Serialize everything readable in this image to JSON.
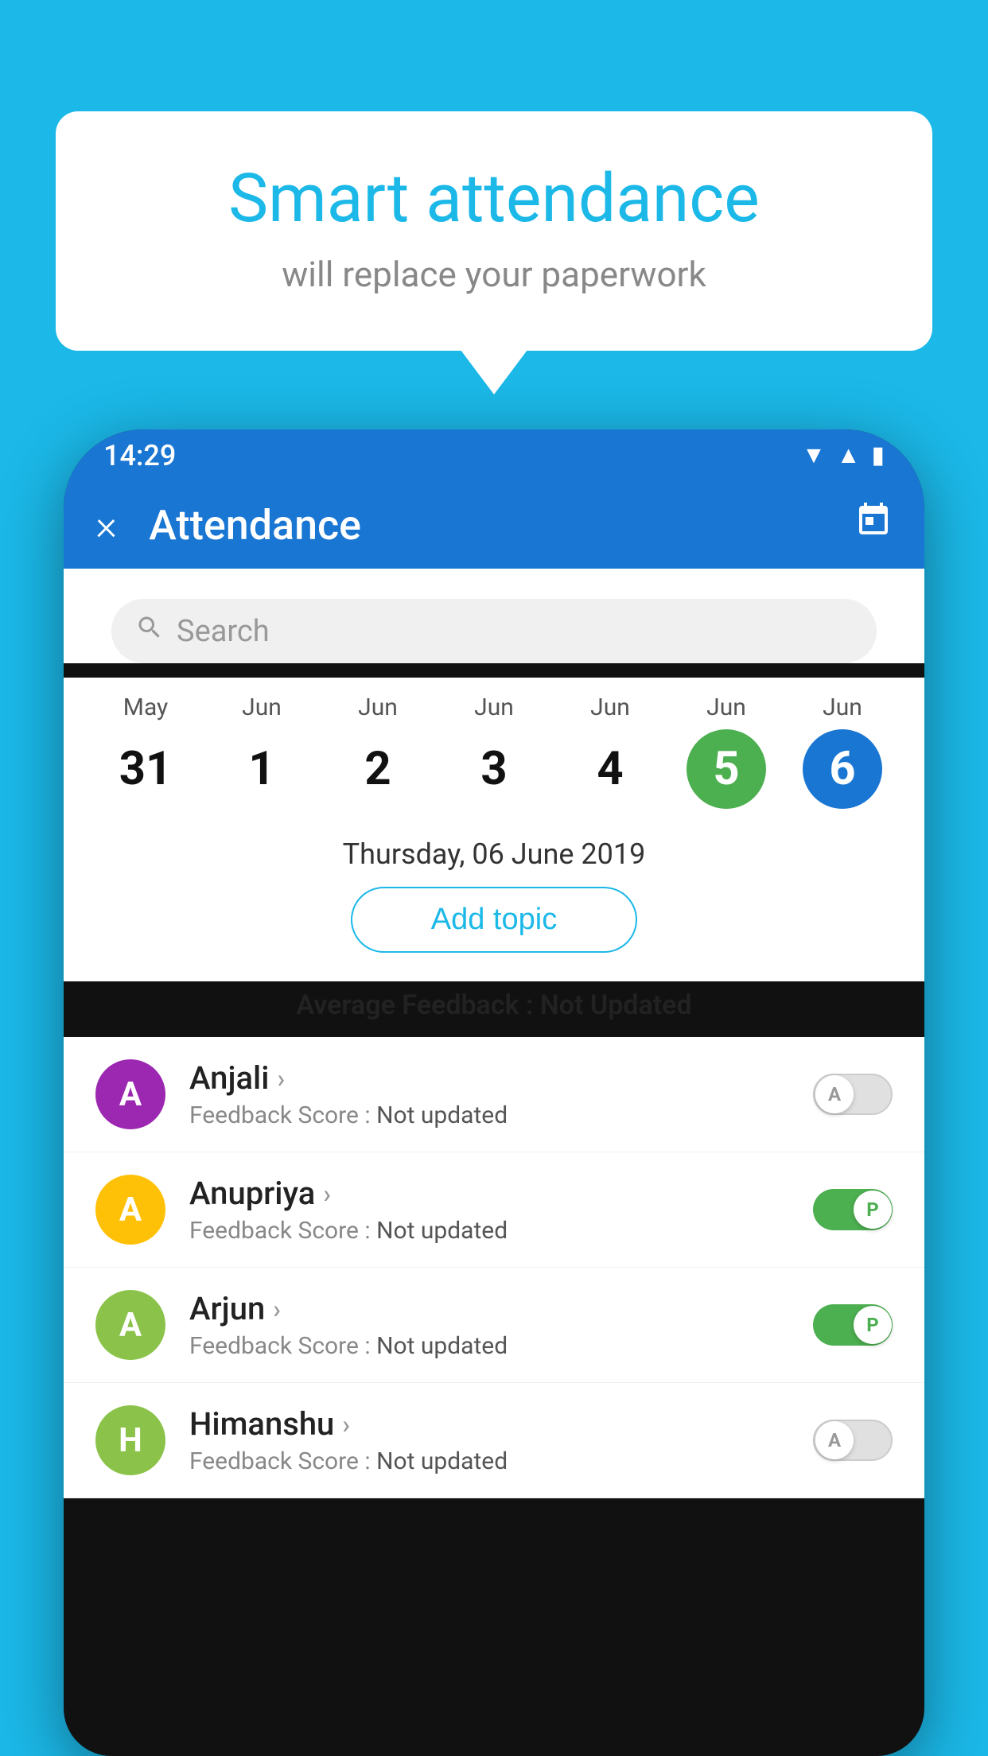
{
  "background_color": "#1BB8E8",
  "bubble": {
    "title": "Smart attendance",
    "subtitle": "will replace your paperwork"
  },
  "status_bar": {
    "time": "14:29",
    "icons": [
      "wifi",
      "signal",
      "battery"
    ]
  },
  "app_bar": {
    "title": "Attendance",
    "close_label": "×",
    "calendar_icon": "📅"
  },
  "search": {
    "placeholder": "Search"
  },
  "calendar": {
    "dates": [
      {
        "month": "May",
        "day": "31",
        "state": "normal"
      },
      {
        "month": "Jun",
        "day": "1",
        "state": "normal"
      },
      {
        "month": "Jun",
        "day": "2",
        "state": "normal"
      },
      {
        "month": "Jun",
        "day": "3",
        "state": "normal"
      },
      {
        "month": "Jun",
        "day": "4",
        "state": "normal"
      },
      {
        "month": "Jun",
        "day": "5",
        "state": "today"
      },
      {
        "month": "Jun",
        "day": "6",
        "state": "selected"
      }
    ]
  },
  "selected_date_label": "Thursday, 06 June 2019",
  "add_topic_label": "Add topic",
  "avg_feedback": {
    "label": "Average Feedback : ",
    "value": "Not Updated"
  },
  "students": [
    {
      "name": "Anjali",
      "avatar_letter": "A",
      "avatar_color": "#9C27B0",
      "feedback": "Not updated",
      "attendance": "absent",
      "toggle_letter": "A"
    },
    {
      "name": "Anupriya",
      "avatar_letter": "A",
      "avatar_color": "#FFC107",
      "feedback": "Not updated",
      "attendance": "present",
      "toggle_letter": "P"
    },
    {
      "name": "Arjun",
      "avatar_letter": "A",
      "avatar_color": "#8BC34A",
      "feedback": "Not updated",
      "attendance": "present",
      "toggle_letter": "P"
    },
    {
      "name": "Himanshu",
      "avatar_letter": "H",
      "avatar_color": "#8BC34A",
      "feedback": "Not updated",
      "attendance": "absent",
      "toggle_letter": "A"
    }
  ]
}
